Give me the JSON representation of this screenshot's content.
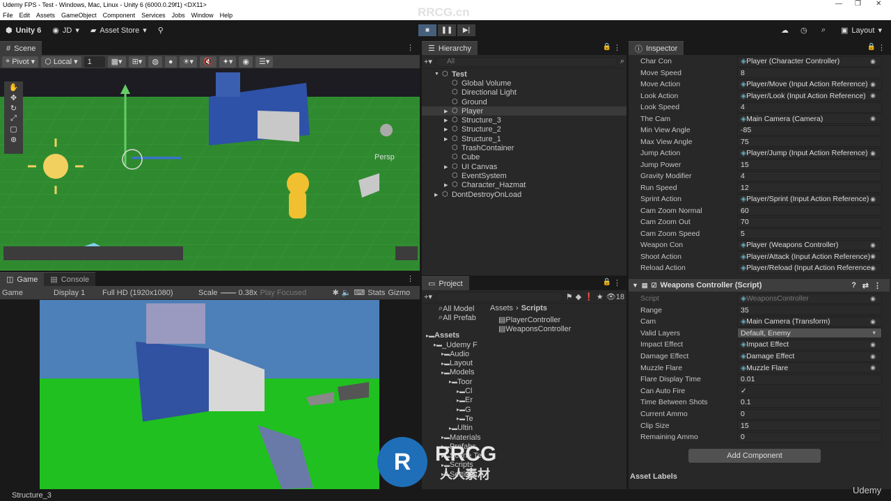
{
  "window": {
    "title": "Udemy FPS - Test - Windows, Mac, Linux - Unity 6 (6000.0.29f1) <DX11>",
    "controls": [
      "—",
      "❐",
      "✕"
    ]
  },
  "menu": [
    "File",
    "Edit",
    "Assets",
    "GameObject",
    "Component",
    "Services",
    "Jobs",
    "Window",
    "Help"
  ],
  "toolbar": {
    "unity": "Unity 6",
    "account": "JD",
    "asset_store": "Asset Store",
    "layout": "Layout"
  },
  "scene": {
    "tab": "Scene",
    "pivot": "Pivot",
    "local": "Local",
    "grid_value": "1",
    "persp": "Persp"
  },
  "game": {
    "tab": "Game",
    "console_tab": "Console",
    "mode": "Game",
    "display": "Display 1",
    "resolution": "Full HD (1920x1080)",
    "scale_label": "Scale",
    "scale_value": "0.38x",
    "play_focused": "Play Focused",
    "stats": "Stats",
    "gizmos": "Gizmo"
  },
  "hierarchy": {
    "tab": "Hierarchy",
    "search": "All",
    "items": [
      {
        "label": "Test",
        "indent": 0,
        "bold": true,
        "arrow": "▼"
      },
      {
        "label": "Global Volume",
        "indent": 1
      },
      {
        "label": "Directional Light",
        "indent": 1
      },
      {
        "label": "Ground",
        "indent": 1
      },
      {
        "label": "Player",
        "indent": 1,
        "arrow": "▶",
        "sel": true
      },
      {
        "label": "Structure_3",
        "indent": 1,
        "arrow": "▶"
      },
      {
        "label": "Structure_2",
        "indent": 1,
        "arrow": "▶"
      },
      {
        "label": "Structure_1",
        "indent": 1,
        "arrow": "▶"
      },
      {
        "label": "TrashContainer",
        "indent": 1
      },
      {
        "label": "Cube",
        "indent": 1
      },
      {
        "label": "UI Canvas",
        "indent": 1,
        "arrow": "▶"
      },
      {
        "label": "EventSystem",
        "indent": 1
      },
      {
        "label": "Character_Hazmat",
        "indent": 1,
        "arrow": "▶"
      },
      {
        "label": "DontDestroyOnLoad",
        "indent": 0,
        "arrow": "▶"
      }
    ]
  },
  "project": {
    "tab": "Project",
    "count": "18",
    "breadcrumb_root": "Assets",
    "breadcrumb_sep": "›",
    "breadcrumb_leaf": "Scripts",
    "favorites": [
      "All Model",
      "All Prefab"
    ],
    "tree": [
      {
        "label": "Assets",
        "indent": 0,
        "bold": true
      },
      {
        "label": "_Udemy F",
        "indent": 1
      },
      {
        "label": "Audio",
        "indent": 2
      },
      {
        "label": "Layout",
        "indent": 2
      },
      {
        "label": "Models",
        "indent": 2
      },
      {
        "label": "Toor",
        "indent": 3
      },
      {
        "label": "Cl",
        "indent": 4
      },
      {
        "label": "Er",
        "indent": 4
      },
      {
        "label": "G",
        "indent": 4
      },
      {
        "label": "Te",
        "indent": 4
      },
      {
        "label": "Ultin",
        "indent": 3
      },
      {
        "label": "Materials",
        "indent": 2
      },
      {
        "label": "Prefabs",
        "indent": 2
      },
      {
        "label": "Scene Te",
        "indent": 2
      },
      {
        "label": "Scripts",
        "indent": 2
      },
      {
        "label": "Settings",
        "indent": 2
      }
    ],
    "files": [
      "PlayerController",
      "WeaponsController"
    ]
  },
  "inspector": {
    "tab": "Inspector",
    "player_rows": [
      {
        "label": "Char Con",
        "value": "Player (Character Controller)",
        "ref": true
      },
      {
        "label": "Move Speed",
        "value": "8"
      },
      {
        "label": "Move Action",
        "value": "Player/Move (Input Action Reference)",
        "ref": true
      },
      {
        "label": "Look Action",
        "value": "Player/Look (Input Action Reference)",
        "ref": true
      },
      {
        "label": "Look Speed",
        "value": "4"
      },
      {
        "label": "The Cam",
        "value": "Main Camera (Camera)",
        "ref": true
      },
      {
        "label": "Min View Angle",
        "value": "-85"
      },
      {
        "label": "Max View Angle",
        "value": "75"
      },
      {
        "label": "Jump Action",
        "value": "Player/Jump (Input Action Reference)",
        "ref": true
      },
      {
        "label": "Jump Power",
        "value": "15"
      },
      {
        "label": "Gravity Modifier",
        "value": "4"
      },
      {
        "label": "Run Speed",
        "value": "12"
      },
      {
        "label": "Sprint Action",
        "value": "Player/Sprint (Input Action Reference)",
        "ref": true
      },
      {
        "label": "Cam Zoom Normal",
        "value": "60"
      },
      {
        "label": "Cam Zoom Out",
        "value": "70"
      },
      {
        "label": "Cam Zoom Speed",
        "value": "5"
      },
      {
        "label": "Weapon Con",
        "value": "Player (Weapons Controller)",
        "ref": true
      },
      {
        "label": "Shoot Action",
        "value": "Player/Attack (Input Action Reference)",
        "ref": true
      },
      {
        "label": "Reload Action",
        "value": "Player/Reload (Input Action Reference",
        "ref": true
      }
    ],
    "weapons_header": "Weapons Controller (Script)",
    "weapons_rows": [
      {
        "label": "Script",
        "value": "WeaponsController",
        "ref": true,
        "dim": true
      },
      {
        "label": "Range",
        "value": "35"
      },
      {
        "label": "Cam",
        "value": "Main Camera (Transform)",
        "ref": true
      },
      {
        "label": "Valid Layers",
        "value": "Default, Enemy",
        "dropdown": true
      },
      {
        "label": "Impact Effect",
        "value": "Impact Effect",
        "ref": true
      },
      {
        "label": "Damage Effect",
        "value": "Damage Effect",
        "ref": true
      },
      {
        "label": "Muzzle Flare",
        "value": "Muzzle Flare",
        "ref": true
      },
      {
        "label": "Flare Display Time",
        "value": "0.01"
      },
      {
        "label": "Can Auto Fire",
        "value": "✓",
        "check": true
      },
      {
        "label": "Time Between Shots",
        "value": "0.1"
      },
      {
        "label": "Current Ammo",
        "value": "0"
      },
      {
        "label": "Clip Size",
        "value": "15"
      },
      {
        "label": "Remaining Ammo",
        "value": "0"
      }
    ],
    "add_component": "Add Component",
    "asset_labels": "Asset Labels"
  },
  "status": "Structure_3",
  "watermark": {
    "top": "RRCG.cn",
    "logo": "RRCG",
    "logo_sub": "人人素材",
    "udemy": "Udemy"
  }
}
